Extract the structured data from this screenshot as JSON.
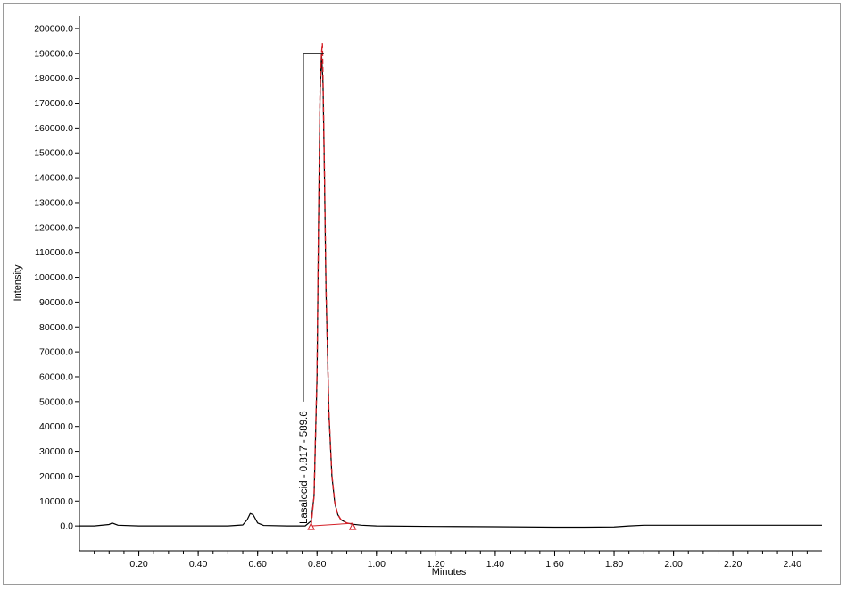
{
  "chart_data": {
    "type": "line",
    "xlabel": "Minutes",
    "ylabel": "Intensity",
    "xlim": [
      0,
      2.5
    ],
    "ylim": [
      -10000,
      205000
    ],
    "x_ticks": [
      0.2,
      0.4,
      0.6,
      0.8,
      1.0,
      1.2,
      1.4,
      1.6,
      1.8,
      2.0,
      2.2,
      2.4
    ],
    "x_tick_labels": [
      "0.20",
      "0.40",
      "0.60",
      "0.80",
      "1.00",
      "1.20",
      "1.40",
      "1.60",
      "1.80",
      "2.00",
      "2.20",
      "2.40"
    ],
    "y_ticks": [
      0,
      10000,
      20000,
      30000,
      40000,
      50000,
      60000,
      70000,
      80000,
      90000,
      100000,
      110000,
      120000,
      130000,
      140000,
      150000,
      160000,
      170000,
      180000,
      190000,
      200000
    ],
    "y_tick_labels": [
      "0.0",
      "10000.0",
      "20000.0",
      "30000.0",
      "40000.0",
      "50000.0",
      "60000.0",
      "70000.0",
      "80000.0",
      "90000.0",
      "100000.0",
      "110000.0",
      "120000.0",
      "130000.0",
      "140000.0",
      "150000.0",
      "160000.0",
      "170000.0",
      "180000.0",
      "190000.0",
      "200000.0"
    ],
    "grid": false,
    "series": [
      {
        "color": "#000000",
        "x": [
          0.0,
          0.05,
          0.1,
          0.11,
          0.13,
          0.2,
          0.3,
          0.4,
          0.5,
          0.55,
          0.565,
          0.575,
          0.585,
          0.6,
          0.62,
          0.7,
          0.76,
          0.78,
          0.79,
          0.8,
          0.805,
          0.81,
          0.815,
          0.82,
          0.825,
          0.83,
          0.84,
          0.85,
          0.86,
          0.87,
          0.88,
          0.9,
          0.92,
          0.95,
          1.0,
          1.2,
          1.4,
          1.6,
          1.7,
          1.8,
          1.85,
          1.9,
          2.0,
          2.2,
          2.4,
          2.5
        ],
        "y": [
          0,
          0,
          600,
          1200,
          300,
          0,
          0,
          0,
          0,
          400,
          2500,
          5000,
          4500,
          1200,
          200,
          0,
          0,
          2000,
          12000,
          60000,
          120000,
          172000,
          190000,
          178000,
          140000,
          95000,
          45000,
          20000,
          9000,
          4500,
          2500,
          1200,
          700,
          300,
          0,
          -200,
          -300,
          -500,
          -500,
          -400,
          0,
          300,
          300,
          300,
          300,
          300
        ]
      },
      {
        "color": "#d42027",
        "x": [
          0.78,
          0.79,
          0.8,
          0.805,
          0.81,
          0.815,
          0.818,
          0.82,
          0.825,
          0.83,
          0.84,
          0.85,
          0.86,
          0.87,
          0.88,
          0.9,
          0.92
        ],
        "y": [
          0,
          12000,
          62000,
          122000,
          174000,
          190000,
          194000,
          180000,
          142000,
          97000,
          46000,
          20500,
          9200,
          4600,
          2600,
          1200,
          600
        ]
      }
    ],
    "peak": {
      "label": "Lasalocid - 0.817 - 589.6",
      "start_x": 0.78,
      "end_x": 0.92,
      "apex_x": 0.817,
      "apex_y": 190000
    }
  }
}
